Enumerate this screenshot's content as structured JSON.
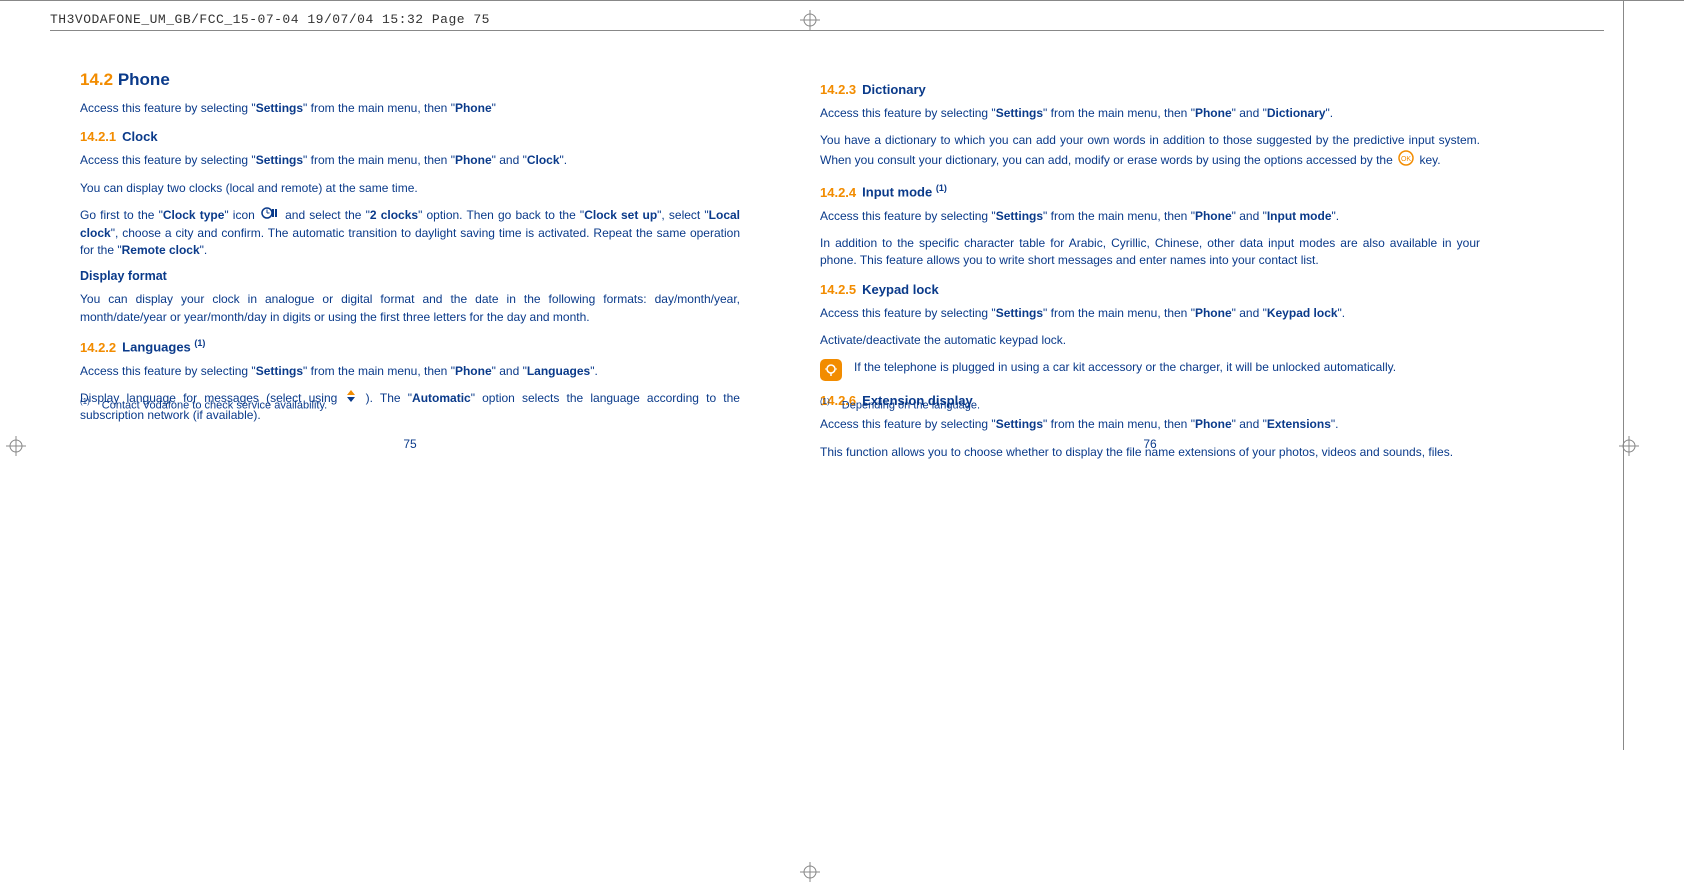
{
  "header": {
    "text": "TH3VODAFONE_UM_GB/FCC_15-07-04  19/07/04  15:32  Page 75"
  },
  "left": {
    "section_num": "14.2",
    "section_title": "Phone",
    "intro": "Access this feature by selecting \"",
    "intro_b1": "Settings",
    "intro_mid": "\" from the main menu, then \"",
    "intro_b2": "Phone",
    "intro_end": "\"",
    "s1_num": "14.2.1",
    "s1_title": "Clock",
    "s1_p1_a": "Access this feature by selecting \"",
    "s1_p1_b1": "Settings",
    "s1_p1_b": "\" from the main menu, then \"",
    "s1_p1_b2": "Phone",
    "s1_p1_c": "\" and \"",
    "s1_p1_b3": "Clock",
    "s1_p1_d": "\".",
    "s1_p2": "You can display two clocks (local and remote) at the same time.",
    "s1_p3_a": "Go first to the \"",
    "s1_p3_b1": "Clock type",
    "s1_p3_b": "\" icon ",
    "s1_p3_c": " and select the \"",
    "s1_p3_b2": "2 clocks",
    "s1_p3_d": "\" option. Then go back to the \"",
    "s1_p3_b3": "Clock set up",
    "s1_p3_e": "\", select \"",
    "s1_p3_b4": "Local clock",
    "s1_p3_f": "\", choose a city and confirm. The automatic transition to daylight saving time is activated. Repeat the same operation for the \"",
    "s1_p3_b5": "Remote clock",
    "s1_p3_g": "\".",
    "df_title": "Display format",
    "df_p": "You can display your clock in analogue or digital format and the date in the following formats: day/month/year, month/date/year or year/month/day in digits or using the first three letters for the day and month.",
    "s2_num": "14.2.2",
    "s2_title": "Languages ",
    "s2_sup": "(1)",
    "s2_p1_a": "Access this feature by selecting \"",
    "s2_p1_b1": "Settings",
    "s2_p1_b": "\" from the main menu, then \"",
    "s2_p1_b2": "Phone",
    "s2_p1_c": "\" and \"",
    "s2_p1_b3": "Languages",
    "s2_p1_d": "\".",
    "s2_p2_a": "Display language for messages (select using ",
    "s2_p2_b": "). The \"",
    "s2_p2_b1": "Automatic",
    "s2_p2_c": "\" option selects the language according to the subscription network (if available).",
    "footnote_sup": "(1)",
    "footnote": "Contact Vodafone to check service availability.",
    "pagenum": "75"
  },
  "right": {
    "s3_num": "14.2.3",
    "s3_title": "Dictionary",
    "s3_p1_a": "Access this feature by selecting \"",
    "s3_p1_b1": "Settings",
    "s3_p1_b": "\" from the main menu, then \"",
    "s3_p1_b2": "Phone",
    "s3_p1_c": "\" and \"",
    "s3_p1_b3": "Dictionary",
    "s3_p1_d": "\".",
    "s3_p2_a": "You have a dictionary to which you can add your own words in addition to those suggested by the predictive input system. When you consult your dictionary, you can add, modify or erase words by using the options accessed by the ",
    "s3_p2_b": " key.",
    "s4_num": "14.2.4",
    "s4_title": "Input mode ",
    "s4_sup": "(1)",
    "s4_p1_a": "Access this feature by selecting \"",
    "s4_p1_b1": "Settings",
    "s4_p1_b": "\" from the main menu, then \"",
    "s4_p1_b2": "Phone",
    "s4_p1_c": "\" and \"",
    "s4_p1_b3": "Input mode",
    "s4_p1_d": "\".",
    "s4_p2": "In addition to the specific character table for Arabic, Cyrillic, Chinese, other data input modes are also available in your phone. This feature allows you to write short messages and enter names into your contact list.",
    "s5_num": "14.2.5",
    "s5_title": "Keypad lock",
    "s5_p1_a": "Access this feature by selecting \"",
    "s5_p1_b1": "Settings",
    "s5_p1_b": "\" from the main menu, then \"",
    "s5_p1_b2": "Phone",
    "s5_p1_c": "\" and \"",
    "s5_p1_b3": "Keypad lock",
    "s5_p1_d": "\".",
    "s5_p2": "Activate/deactivate the automatic keypad lock.",
    "s5_tip": "If the telephone is plugged in using a car kit accessory or the charger, it will be unlocked automatically.",
    "s6_num": "14.2.6",
    "s6_title": "Extension display",
    "s6_p1_a": "Access this feature by selecting \"",
    "s6_p1_b1": "Settings",
    "s6_p1_b": "\" from the main menu, then \"",
    "s6_p1_b2": "Phone",
    "s6_p1_c": "\" and \"",
    "s6_p1_b3": "Extensions",
    "s6_p1_d": "\".",
    "s6_p2": "This function allows you to choose whether to display the file name extensions of your photos, videos and sounds, files.",
    "footnote_sup": "(1)",
    "footnote": "Depending on the language.",
    "pagenum": "76"
  }
}
